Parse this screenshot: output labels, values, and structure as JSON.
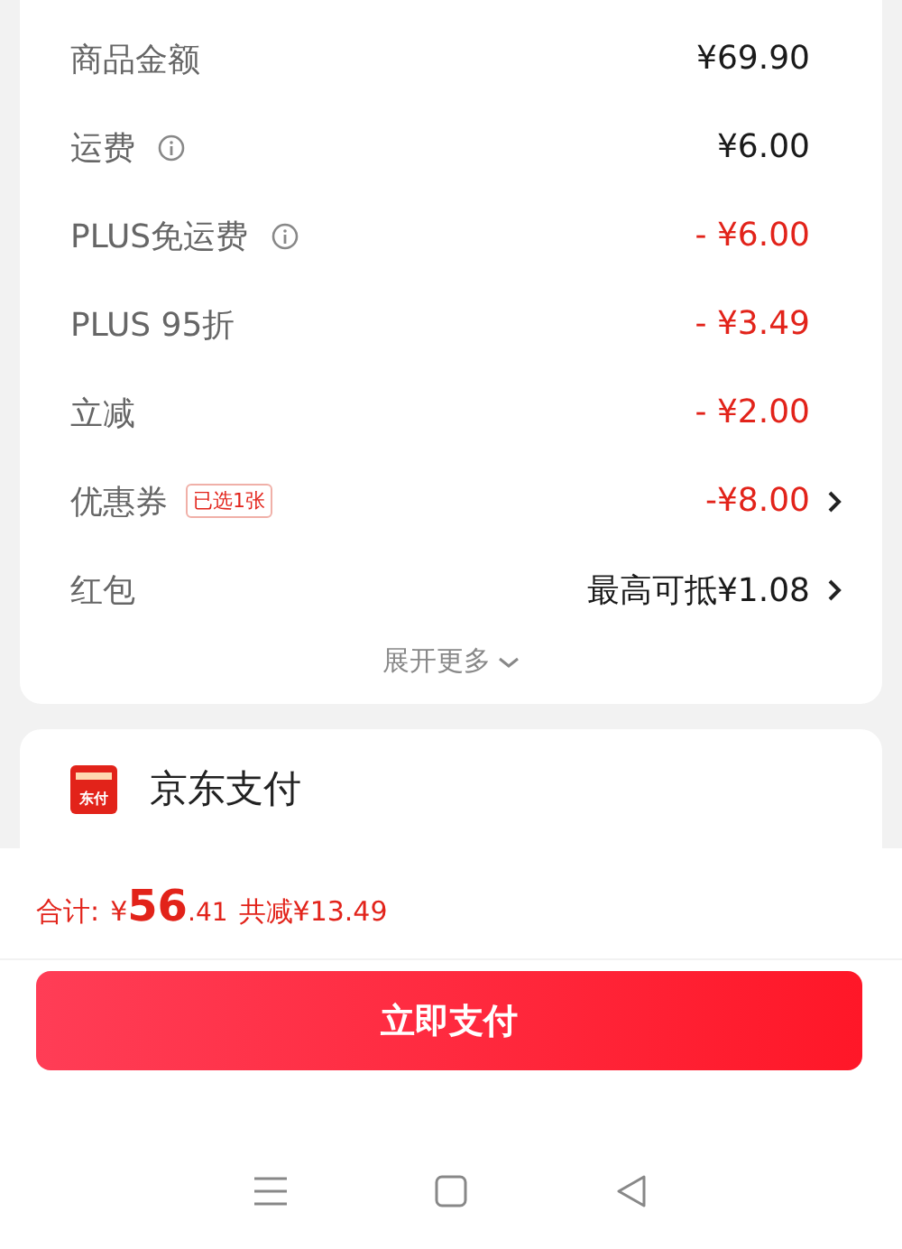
{
  "fees": [
    {
      "label": "商品金额",
      "info": false,
      "value": "¥69.90",
      "kind": "normal",
      "chevron": false
    },
    {
      "label": "运费",
      "info": true,
      "value": "¥6.00",
      "kind": "normal",
      "chevron": false
    },
    {
      "label": "PLUS免运费",
      "info": true,
      "value": "- ¥6.00",
      "kind": "discount",
      "chevron": false
    },
    {
      "label": "PLUS 95折",
      "info": false,
      "value": "- ¥3.49",
      "kind": "discount",
      "chevron": false
    },
    {
      "label": "立减",
      "info": false,
      "value": "- ¥2.00",
      "kind": "discount",
      "chevron": false
    },
    {
      "label": "优惠券",
      "info": false,
      "badge": "已选1张",
      "value": "-¥8.00",
      "kind": "discount",
      "chevron": true
    },
    {
      "label": "红包",
      "info": false,
      "value": "最高可抵¥1.08",
      "kind": "normal",
      "chevron": true
    }
  ],
  "expand": "展开更多",
  "payment": {
    "logo_text": "东付",
    "name": "京东支付"
  },
  "total": {
    "label": "合计:",
    "currency": "¥",
    "integer": "56",
    "decimal": ".41",
    "saved": "共减¥13.49"
  },
  "pay_button": "立即支付"
}
